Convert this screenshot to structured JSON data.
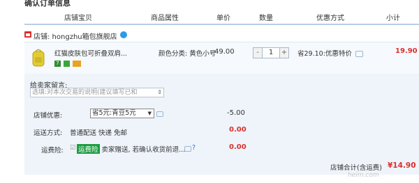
{
  "section_title": "确认订单信息",
  "columns": [
    "店铺宝贝",
    "商品属性",
    "单价",
    "数量",
    "优惠方式",
    "小计"
  ],
  "shop": {
    "label": "店铺: hongzhu箱包旗舰店"
  },
  "item": {
    "title": "红猫皮肤包可折叠双肩...",
    "attribute": "颜色分类: 黄色小号",
    "price": "49.00",
    "qty_minus": "-",
    "quantity": "1",
    "qty_plus": "+",
    "discount": "省29.10:优惠特价",
    "subtotal": "19.90",
    "badge_text": "7"
  },
  "message": {
    "label": "给卖家留言:",
    "placeholder": "选填:对本次交易的说明(建议填写已和"
  },
  "shop_coupon": {
    "label": "店铺优惠:",
    "selected": "省5元:青豆5元",
    "amount": "-5.00"
  },
  "shipping": {
    "label": "运送方式:",
    "value": "普通配送 快递 免邮",
    "amount": "0.00"
  },
  "insurance": {
    "label": "运费险:",
    "tag": "运费险",
    "text": "卖家赠送, 若确认收货前退...",
    "amount": "0.00"
  },
  "total": {
    "label": "店铺合计(含运费)",
    "value": "¥14.90"
  },
  "watermark": "heim.com",
  "colors": {
    "accent_red": "#d9302c",
    "header_border": "#b8cde6",
    "panel_bg": "#eef4fa",
    "tag_green": "#1a9e3f"
  }
}
